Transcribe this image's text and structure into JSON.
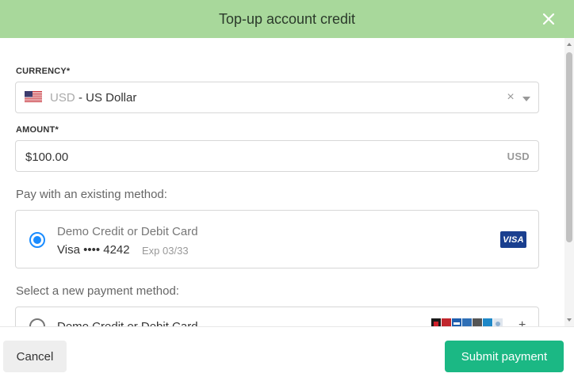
{
  "dialog": {
    "title": "Top-up account credit",
    "header_color": "#a8d89b"
  },
  "currency": {
    "label": "CURRENCY*",
    "code": "USD",
    "name": "- US Dollar",
    "flag_icon": "us-flag-icon"
  },
  "amount": {
    "label": "AMOUNT*",
    "value": "$100.00",
    "suffix": "USD"
  },
  "existing_methods": {
    "heading": "Pay with an existing method:",
    "items": [
      {
        "title": "Demo Credit or Debit Card",
        "brand_line": "Visa •••• 4242",
        "expiry": "Exp 03/33",
        "selected": true,
        "badge": "VISA"
      }
    ]
  },
  "new_methods": {
    "heading": "Select a new payment method:",
    "items": [
      {
        "title": "Demo Credit or Debit Card",
        "selected": false,
        "expand_icon": "plus-icon"
      }
    ]
  },
  "footer": {
    "cancel_label": "Cancel",
    "submit_label": "Submit payment",
    "submit_color": "#1bb884"
  }
}
